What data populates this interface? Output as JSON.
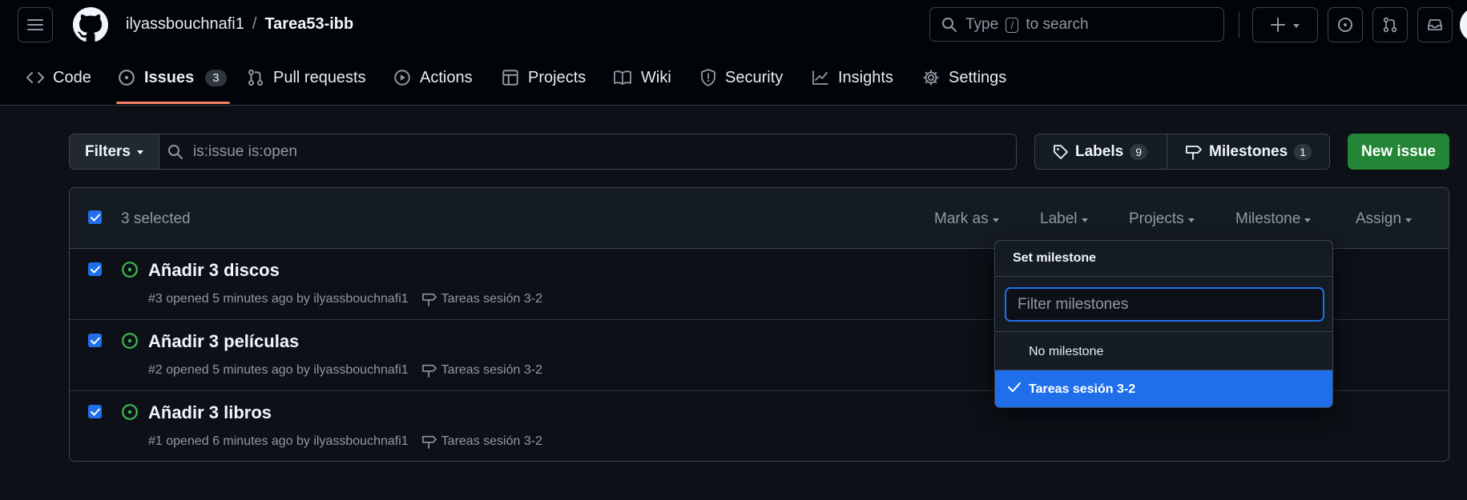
{
  "header": {
    "owner": "ilyassbouchnafi1",
    "separator": "/",
    "repo": "Tarea53-ibb",
    "search_before": "Type",
    "search_key": "/",
    "search_after": "to search"
  },
  "nav": {
    "code": "Code",
    "issues": "Issues",
    "issues_count": "3",
    "pulls": "Pull requests",
    "actions": "Actions",
    "projects": "Projects",
    "wiki": "Wiki",
    "security": "Security",
    "insights": "Insights",
    "settings": "Settings"
  },
  "toolbar": {
    "filters_label": "Filters",
    "filter_query": "is:issue is:open",
    "labels_label": "Labels",
    "labels_count": "9",
    "milestones_label": "Milestones",
    "milestones_count": "1",
    "new_issue_label": "New issue"
  },
  "list_header": {
    "selected_text": "3 selected",
    "mark_as": "Mark as",
    "label": "Label",
    "projects": "Projects",
    "milestone": "Milestone",
    "assign": "Assign"
  },
  "issues": [
    {
      "title": "Añadir 3 discos",
      "meta": "#3 opened 5 minutes ago by ilyassbouchnafi1",
      "milestone": "Tareas sesión 3-2"
    },
    {
      "title": "Añadir 3 películas",
      "meta": "#2 opened 5 minutes ago by ilyassbouchnafi1",
      "milestone": "Tareas sesión 3-2"
    },
    {
      "title": "Añadir 3 libros",
      "meta": "#1 opened 6 minutes ago by ilyassbouchnafi1",
      "milestone": "Tareas sesión 3-2"
    }
  ],
  "milestone_menu": {
    "title": "Set milestone",
    "filter_placeholder": "Filter milestones",
    "no_milestone": "No milestone",
    "selected_item": "Tareas sesión 3-2"
  },
  "colors": {
    "background": "#0d1117",
    "header": "#010409",
    "accent_blue": "#1f6feb",
    "open_green": "#3fb950",
    "button_green": "#238636",
    "underline": "#f78166"
  }
}
